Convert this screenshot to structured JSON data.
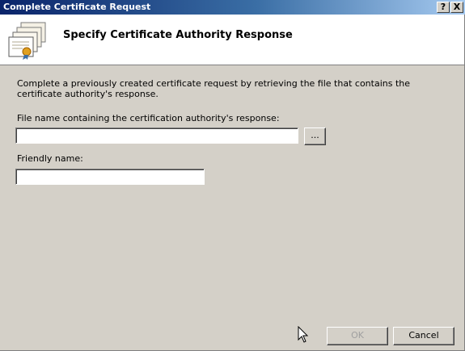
{
  "window": {
    "title": "Complete Certificate Request"
  },
  "titlebar": {
    "help_label": "?",
    "close_label": "X"
  },
  "header": {
    "title": "Specify Certificate Authority Response"
  },
  "form": {
    "description": "Complete a previously created certificate request by retrieving the file that contains the certificate authority's response.",
    "file_label": "File name containing the certification authority's response:",
    "file_value": "",
    "browse_label": "...",
    "friendly_label": "Friendly name:",
    "friendly_value": ""
  },
  "buttons": {
    "ok": "OK",
    "cancel": "Cancel",
    "ok_enabled": false
  },
  "colors": {
    "titlebar_start": "#0a246a",
    "titlebar_end": "#a6caf0",
    "dialog_bg": "#d4d0c8"
  },
  "icons": {
    "header_icon": "certificate-icon",
    "cursor": "mouse-pointer-icon"
  }
}
